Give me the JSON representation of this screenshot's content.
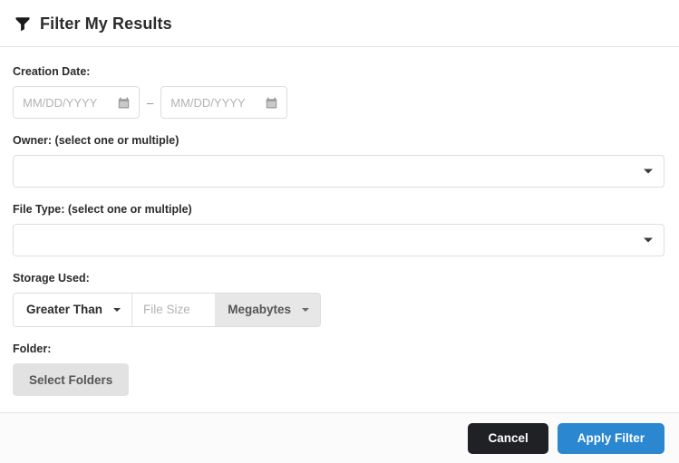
{
  "header": {
    "title": "Filter My Results",
    "icon": "filter-funnel-icon"
  },
  "fields": {
    "creation_date": {
      "label": "Creation Date:",
      "start": {
        "value": "",
        "placeholder": "MM/DD/YYYY",
        "icon": "calendar-icon"
      },
      "separator": "–",
      "end": {
        "value": "",
        "placeholder": "MM/DD/YYYY",
        "icon": "calendar-icon"
      }
    },
    "owner": {
      "label": "Owner: (select one or multiple)",
      "value": "",
      "caret_icon": "caret-down-icon"
    },
    "file_type": {
      "label": "File Type: (select one or multiple)",
      "value": "",
      "caret_icon": "caret-down-icon"
    },
    "storage_used": {
      "label": "Storage Used:",
      "comparator": {
        "value": "Greater Than",
        "caret_icon": "caret-down-icon"
      },
      "size": {
        "value": "",
        "placeholder": "File Size"
      },
      "unit": {
        "value": "Megabytes",
        "caret_icon": "caret-down-icon"
      }
    },
    "folder": {
      "label": "Folder:",
      "button_label": "Select Folders"
    }
  },
  "footer": {
    "cancel_label": "Cancel",
    "apply_label": "Apply Filter"
  },
  "colors": {
    "accent": "#2a87d0",
    "cancel": "#1f2124",
    "muted_fill": "#e7e7e7",
    "border": "#dedede"
  }
}
